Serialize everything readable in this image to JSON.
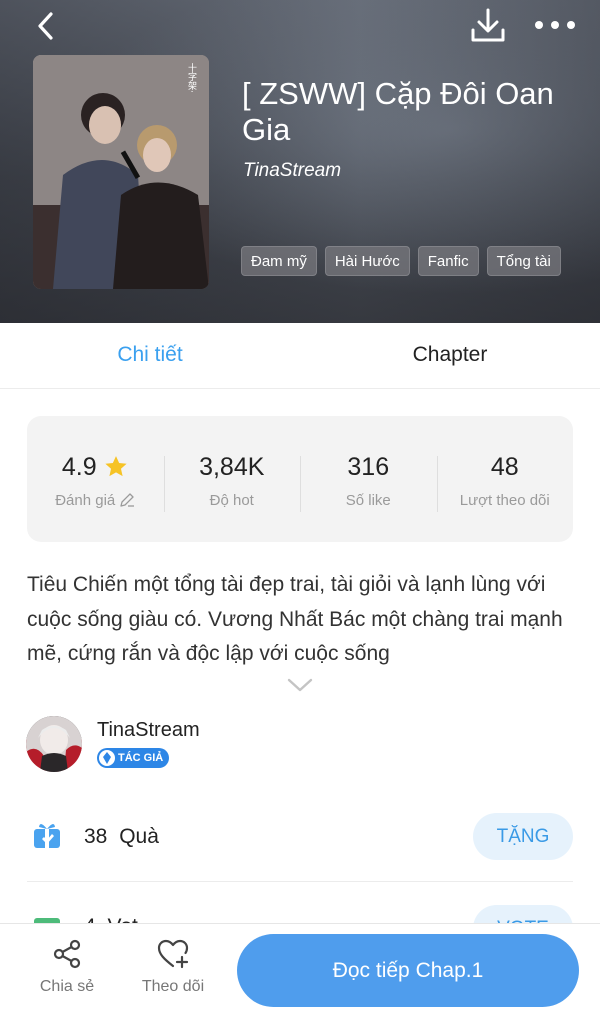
{
  "header": {
    "title": "[ ZSWW] Cặp Đôi Oan Gia",
    "author": "TinaStream",
    "tags": [
      "Đam mỹ",
      "Hài Hước",
      "Fanfic",
      "Tổng tài"
    ],
    "cover_caption": "十字架·"
  },
  "tabs": [
    {
      "label": "Chi tiết",
      "active": true
    },
    {
      "label": "Chapter",
      "active": false
    }
  ],
  "stats": [
    {
      "value": "4.9",
      "label": "Đánh giá"
    },
    {
      "value": "3,84K",
      "label": "Độ hot"
    },
    {
      "value": "316",
      "label": "Số like"
    },
    {
      "value": "48",
      "label": "Lượt theo dõi"
    }
  ],
  "description": "Tiêu Chiến một tổng tài đẹp trai, tài giỏi và lạnh lùng với cuộc sống giàu có. Vương Nhất Bác một chàng trai mạnh mẽ, cứng rắn và độc lập với cuộc sống",
  "author_section": {
    "name": "TinaStream",
    "badge": "TÁC GIẢ"
  },
  "gifts": {
    "count": "38",
    "label": "Quà",
    "button": "TẶNG"
  },
  "votes": {
    "count": "4",
    "label": "Vot",
    "button": "VOTE"
  },
  "bottom_bar": {
    "share_label": "Chia sẻ",
    "follow_label": "Theo dõi",
    "read_button": "Đọc tiếp Chap.1"
  },
  "colors": {
    "accent": "#3aa0ef",
    "primary_button": "#4f9ded",
    "star": "#f6c325"
  }
}
